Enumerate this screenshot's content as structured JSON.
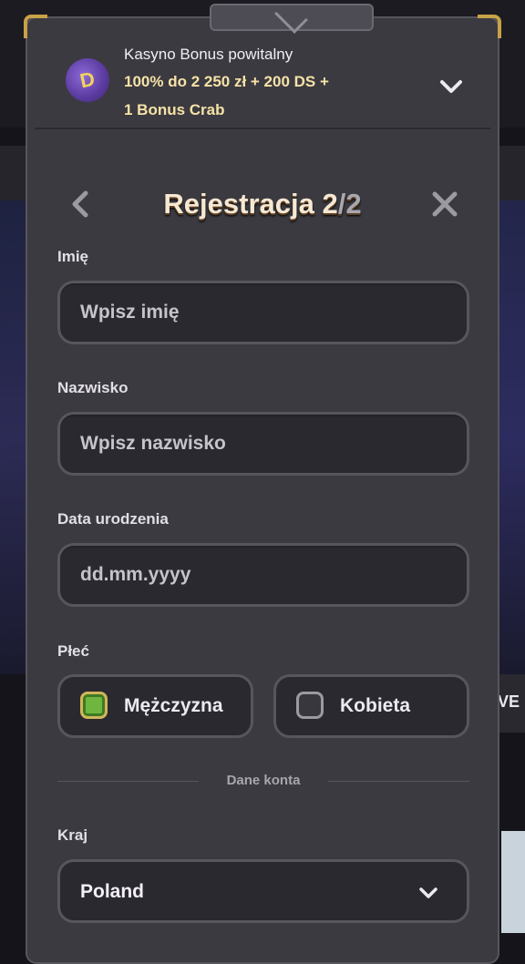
{
  "bonus": {
    "title": "Kasyno Bonus powitalny",
    "line1": "100% do 2 250 zł + 200 DS +",
    "line2": "1 Bonus Crab",
    "logo_letter": "D"
  },
  "header": {
    "title_main": "Rejestracja 2",
    "title_of": "/2",
    "back_icon": "chevron-left-icon",
    "close_icon": "close-icon"
  },
  "form": {
    "first_name": {
      "label": "Imię",
      "placeholder": "Wpisz imię",
      "value": ""
    },
    "last_name": {
      "label": "Nazwisko",
      "placeholder": "Wpisz nazwisko",
      "value": ""
    },
    "birthdate": {
      "label": "Data urodzenia",
      "placeholder": "dd.mm.yyyy",
      "value": ""
    },
    "gender": {
      "label": "Płeć",
      "options": [
        {
          "label": "Mężczyzna",
          "selected": true
        },
        {
          "label": "Kobieta",
          "selected": false
        }
      ]
    },
    "section_divider": "Dane konta",
    "country": {
      "label": "Kraj",
      "value": "Poland"
    }
  },
  "background": {
    "partial_text": "VE"
  },
  "colors": {
    "panel": "#3b3a40",
    "field": "#2a292f",
    "accent_gold": "#c9a247",
    "radio_selected": "#6fb640"
  }
}
